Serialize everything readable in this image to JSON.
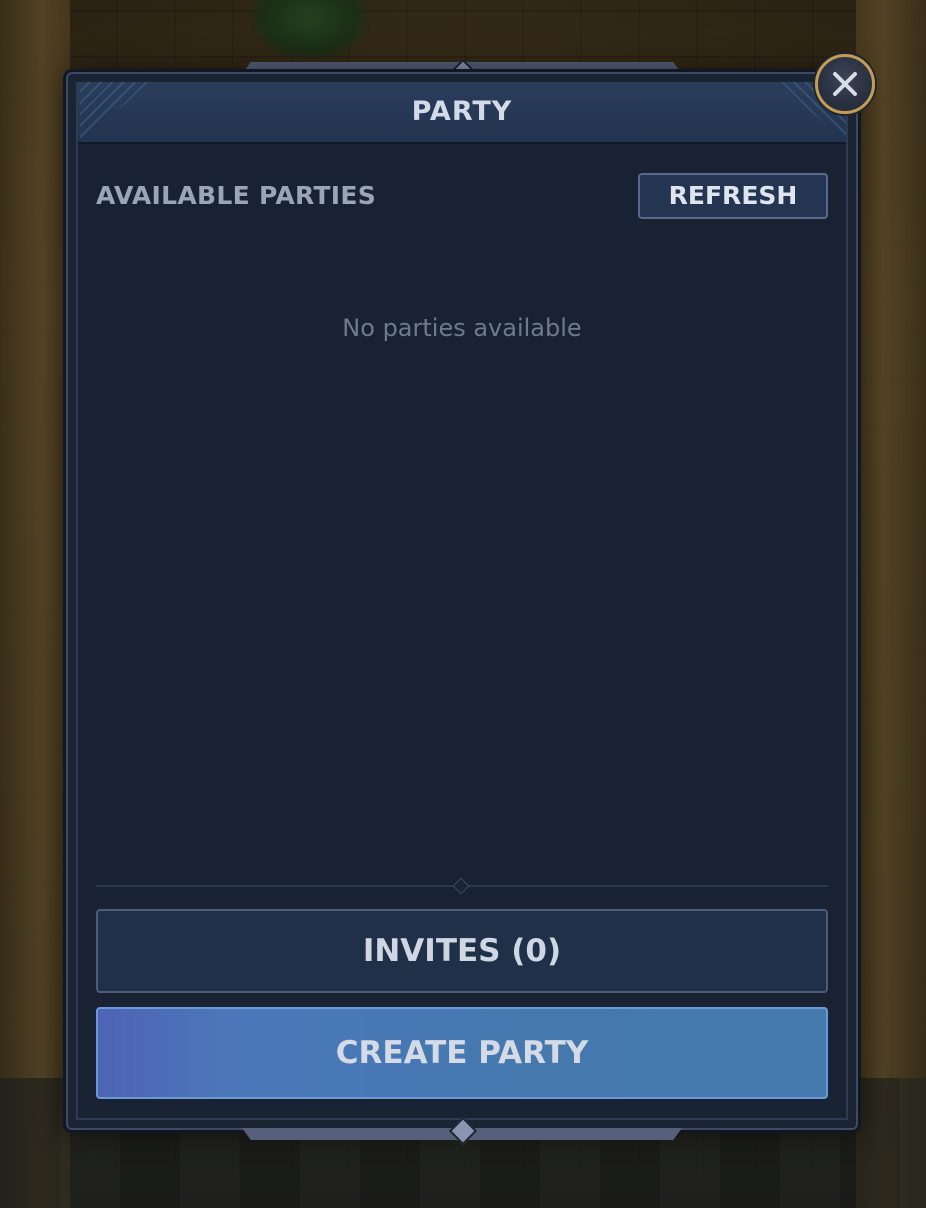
{
  "panel": {
    "title": "PARTY"
  },
  "list": {
    "section_title": "AVAILABLE PARTIES",
    "refresh_label": "REFRESH",
    "empty_message": "No parties available"
  },
  "actions": {
    "invites_label": "INVITES (0)",
    "create_label": "CREATE PARTY"
  },
  "icons": {
    "close": "close-icon"
  },
  "colors": {
    "close_ring": "#c39d53",
    "create_button": "#4a78b4",
    "panel_bg": "#182233"
  }
}
